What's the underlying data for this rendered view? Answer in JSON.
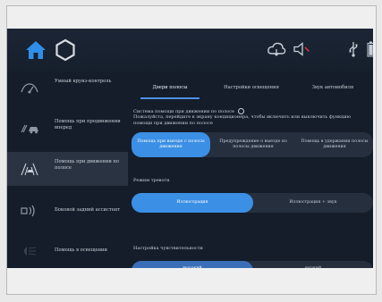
{
  "topbar": {
    "home_icon": "home-icon",
    "hex_icon": "hexagon-icon",
    "status_icons": [
      "cloud-icon",
      "volume-mute-icon",
      "usb-icon",
      "battery-icon"
    ]
  },
  "tabs": [
    {
      "label": "Двери полосы",
      "active": true
    },
    {
      "label": "Настройки освещения",
      "active": false
    },
    {
      "label": "Звук автомобиля",
      "active": false
    }
  ],
  "sidebar": {
    "items": [
      {
        "label": "Умный круиз-контроль",
        "icon": "smart-cruise-icon",
        "active": false
      },
      {
        "label": "Помощь при продвижении вперед",
        "icon": "forward-assist-icon",
        "active": false
      },
      {
        "label": "Помощь при движении по полосе",
        "icon": "lane-assist-icon",
        "active": true
      },
      {
        "label": "Боковой задний ассистент",
        "icon": "rear-side-assist-icon",
        "active": false
      },
      {
        "label": "Помощь в освещении",
        "icon": "lighting-assist-icon",
        "active": false
      }
    ]
  },
  "content": {
    "description_title": "Система помощи при движении по полосе",
    "description_body": "Пожалуйста, перейдите к экрану кондиционера, чтобы включить или выключить функцию помощи при движении по полосе",
    "mode_options": [
      {
        "label": "Помощь при выезде с полосы движения",
        "selected": true
      },
      {
        "label": "Предупреждение о выезде из полосы движения",
        "selected": false
      },
      {
        "label": "Помощь в удержании полосы движения",
        "selected": false
      }
    ],
    "alarm_title": "Режим тревоги",
    "alarm_options": [
      {
        "label": "Иллюстрация",
        "selected": true
      },
      {
        "label": "Иллюстрация + звук",
        "selected": false
      }
    ],
    "sensitivity_title": "Настройка чувствительности",
    "sensitivity_options": [
      {
        "label": "высокий",
        "selected": true
      },
      {
        "label": "низкий",
        "selected": false
      }
    ]
  },
  "colors": {
    "accent": "#3b8fe4",
    "background": "#141d29",
    "segment": "#262f3e",
    "sidebar_active": "#2a3342"
  }
}
